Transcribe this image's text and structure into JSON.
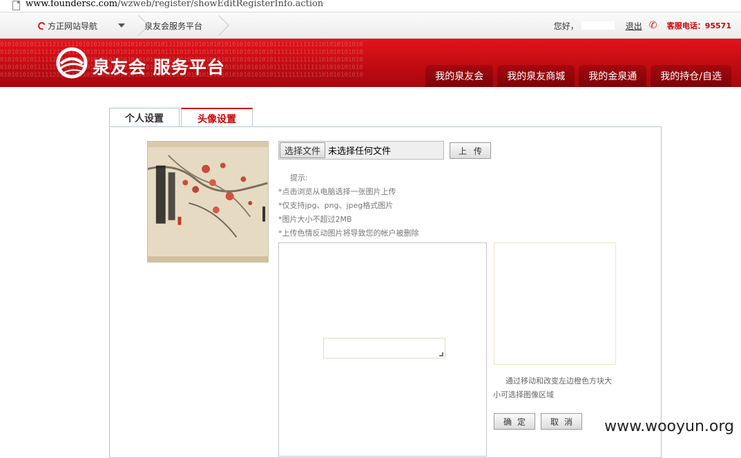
{
  "browser": {
    "url_host": "www.foundersc.com",
    "url_path": "/wzweb/register/showEditRegisterInfo.action"
  },
  "topnav": {
    "site_nav_label": "方正网站导航",
    "breadcrumb": "泉友会服务平台",
    "greeting": "您好，",
    "logout_label": "退出",
    "hotline": "客服电话：95571"
  },
  "banner": {
    "brand_name": "泉友会 服务平台",
    "binary_pattern": "0101010101111121111110101010101010101010101011110101010101010101010101010111111111111101010101010",
    "menu": [
      {
        "label": "我的泉友会"
      },
      {
        "label": "我的泉友商城"
      },
      {
        "label": "我的金泉通"
      },
      {
        "label": "我的持仓/自选"
      }
    ],
    "colors": {
      "primary": "#d4141c",
      "dark": "#7b0408"
    }
  },
  "tabs": [
    {
      "label": "个人设置",
      "active": false
    },
    {
      "label": "头像设置",
      "active": true
    }
  ],
  "upload": {
    "choose_file_label": "选择文件",
    "no_file_text": "未选择任何文件",
    "upload_label": "上传"
  },
  "tips": {
    "title": "提示:",
    "items": [
      "*点击浏览从电脑选择一张图片上传",
      "*仅支持jpg、png、jpeg格式图片",
      "*图片大小不超过2MB",
      "*上传色情反动图片将导致您的帐户被删除"
    ]
  },
  "crop": {
    "hint": "通过移动和改变左边橙色方块大小可选择图像区域",
    "confirm_label": "确定",
    "cancel_label": "取消"
  },
  "watermark": "www.wooyun.org"
}
